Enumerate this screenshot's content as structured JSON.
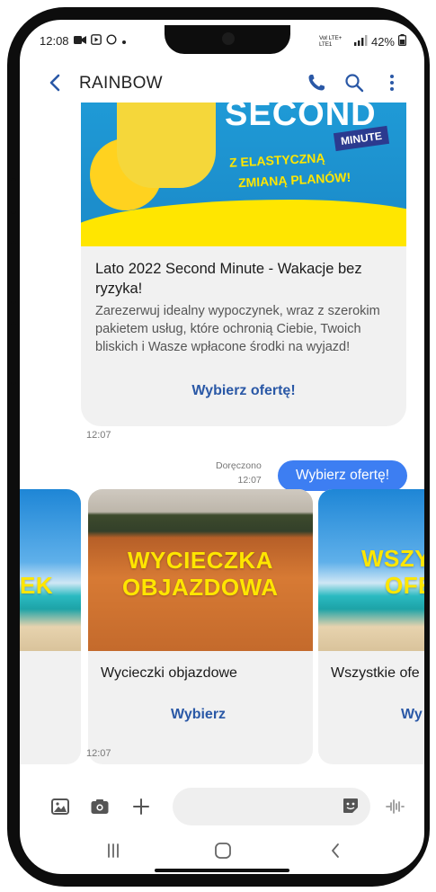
{
  "status_bar": {
    "time": "12:08",
    "network": "Voℓ LTE+ LTE1",
    "battery": "42%"
  },
  "header": {
    "title": "RAINBOW"
  },
  "banner": {
    "headline": "SECOND",
    "badge": "MINUTE",
    "tagline_line1": "Z ELASTYCZNĄ",
    "tagline_line2": "ZMIANĄ PLANÓW!"
  },
  "rich_card": {
    "title": "Lato 2022 Second Minute - Wakacje bez ryzyka!",
    "description": "Zarezerwuj idealny wypoczynek, wraz z szerokim pakietem usług, które ochronią Ciebie, Twoich bliskich i Wasze wpłacone środki na wyjazd!",
    "action": "Wybierz ofertę!",
    "time": "12:07"
  },
  "sent_message": {
    "text": "Wybierz ofertę!",
    "status": "Doręczono",
    "time": "12:07"
  },
  "carousel": {
    "left_partial_overlay": "EK",
    "cards": [
      {
        "overlay_line1": "WYCIECZKA",
        "overlay_line2": "OBJAZDOWA",
        "title": "Wycieczki objazdowe",
        "action": "Wybierz"
      },
      {
        "overlay_line1": "WSZY",
        "overlay_line2": "OFE",
        "title": "Wszystkie ofe",
        "action": "Wy"
      }
    ],
    "time": "12:07"
  },
  "composer": {
    "placeholder": ""
  },
  "colors": {
    "accent": "#3d7ef2",
    "action_text": "#2a58a6",
    "card_bg": "#f1f1f1",
    "banner_yellow": "#ffe600",
    "banner_blue": "#1c8ecc"
  }
}
